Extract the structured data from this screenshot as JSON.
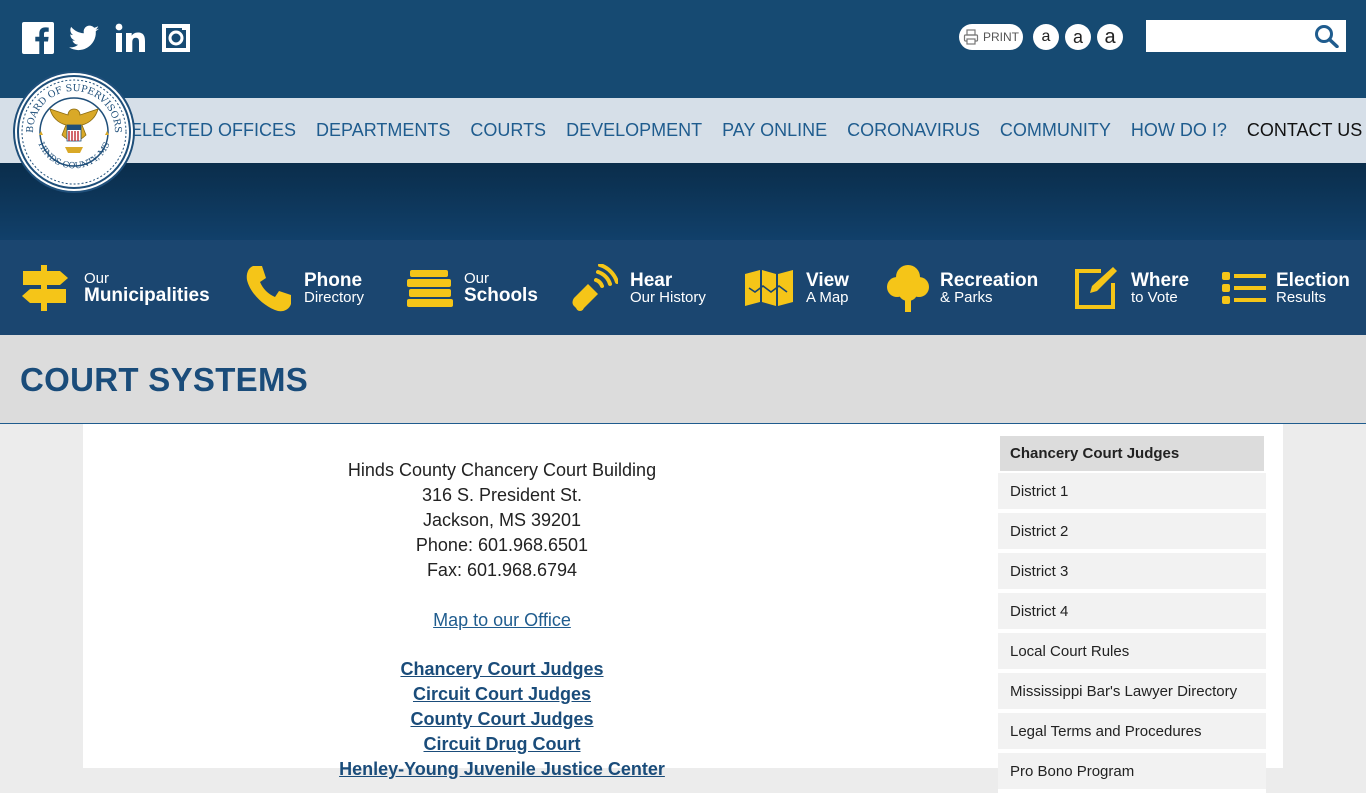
{
  "colors": {
    "header_bg": "#164a72",
    "nav_bg": "#d6dfe8",
    "quick_bg": "#1b4670",
    "accent_yellow": "#f5c518",
    "title_color": "#1a4c7a"
  },
  "social": [
    {
      "icon": "facebook-icon"
    },
    {
      "icon": "twitter-icon"
    },
    {
      "icon": "linkedin-icon"
    },
    {
      "icon": "instagram-icon"
    }
  ],
  "toolbar": {
    "print_label": "PRINT",
    "font_small": "a",
    "font_medium": "a",
    "font_large": "a"
  },
  "search": {
    "placeholder": "",
    "value": ""
  },
  "nav": [
    {
      "label": "ELECTED OFFICES"
    },
    {
      "label": "DEPARTMENTS"
    },
    {
      "label": "COURTS"
    },
    {
      "label": "DEVELOPMENT"
    },
    {
      "label": "PAY ONLINE"
    },
    {
      "label": "CORONAVIRUS"
    },
    {
      "label": "COMMUNITY"
    },
    {
      "label": "HOW DO I?"
    },
    {
      "label": "CONTACT US"
    }
  ],
  "seal": {
    "top_text": "BOARD OF SUPERVISORS",
    "bottom_text": "HINDS COUNTY, MS"
  },
  "quick_links": [
    {
      "small": "Our",
      "big": "Municipalities",
      "icon": "signpost-icon"
    },
    {
      "big": "Phone",
      "small": "Directory",
      "icon": "phone-icon"
    },
    {
      "small": "Our",
      "big": "Schools",
      "icon": "books-icon"
    },
    {
      "big": "Hear",
      "small": "Our History",
      "icon": "megaphone-icon"
    },
    {
      "big": "View",
      "small": "A Map",
      "icon": "map-icon"
    },
    {
      "big": "Recreation",
      "small": "& Parks",
      "icon": "tree-icon"
    },
    {
      "big": "Where",
      "small": "to Vote",
      "icon": "edit-icon"
    },
    {
      "big": "Election",
      "small": "Results",
      "icon": "list-icon"
    }
  ],
  "page": {
    "title": "COURT SYSTEMS"
  },
  "address": {
    "building": "Hinds County Chancery Court Building",
    "street": "316 S. President St.",
    "city": "Jackson, MS  39201",
    "phone": "Phone:  601.968.6501",
    "fax": "Fax:  601.968.6794",
    "map_link": "Map to our Office"
  },
  "court_links": [
    "Chancery Court Judges",
    "Circuit Court Judges",
    "County Court Judges",
    "Circuit Drug Court",
    "Henley-Young Juvenile Justice Center"
  ],
  "sidebar": {
    "heading": "Chancery Court Judges",
    "items": [
      "District 1",
      "District 2",
      "District 3",
      "District 4",
      "Local Court Rules",
      "Mississippi Bar's Lawyer Directory",
      "Legal Terms and Procedures",
      "Pro Bono Program"
    ]
  }
}
